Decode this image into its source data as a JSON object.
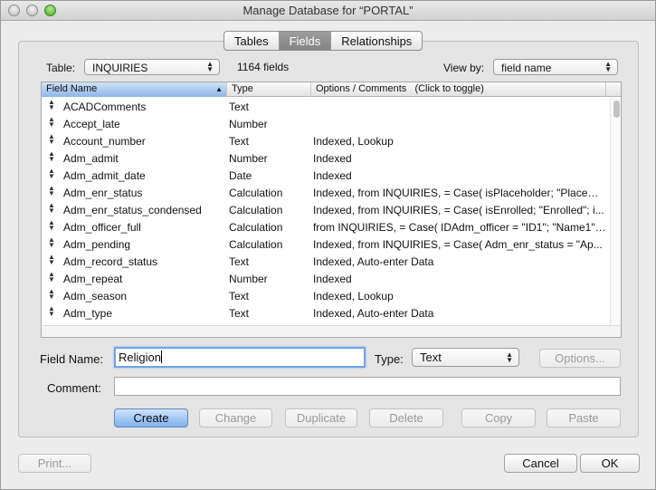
{
  "window": {
    "title": "Manage Database for “PORTAL”"
  },
  "tabs": [
    {
      "label": "Tables",
      "active": false
    },
    {
      "label": "Fields",
      "active": true
    },
    {
      "label": "Relationships",
      "active": false
    }
  ],
  "table_select": {
    "label": "Table:",
    "value": "INQUIRIES"
  },
  "field_count": "1164 fields",
  "view_by": {
    "label": "View by:",
    "value": "field name"
  },
  "columns": {
    "name": "Field Name",
    "type": "Type",
    "options": "Options / Comments",
    "toggle_hint": "(Click to toggle)"
  },
  "rows": [
    {
      "name": "ACADComments",
      "type": "Text",
      "options": ""
    },
    {
      "name": "Accept_late",
      "type": "Number",
      "options": ""
    },
    {
      "name": "Account_number",
      "type": "Text",
      "options": "Indexed, Lookup"
    },
    {
      "name": "Adm_admit",
      "type": "Number",
      "options": "Indexed"
    },
    {
      "name": "Adm_admit_date",
      "type": "Date",
      "options": "Indexed"
    },
    {
      "name": "Adm_enr_status",
      "type": "Calculation",
      "options": "Indexed, from INQUIRIES, = Case( isPlaceholder; \"PlaceHo..."
    },
    {
      "name": "Adm_enr_status_condensed",
      "type": "Calculation",
      "options": "Indexed, from INQUIRIES, = Case( isEnrolled; \"Enrolled\"; i..."
    },
    {
      "name": "Adm_officer_full",
      "type": "Calculation",
      "options": "from INQUIRIES, = Case( IDAdm_officer = \"ID1\"; \"Name1\";..."
    },
    {
      "name": "Adm_pending",
      "type": "Calculation",
      "options": "Indexed, from INQUIRIES, = Case( Adm_enr_status = \"Ap..."
    },
    {
      "name": "Adm_record_status",
      "type": "Text",
      "options": "Indexed, Auto-enter Data"
    },
    {
      "name": "Adm_repeat",
      "type": "Number",
      "options": "Indexed"
    },
    {
      "name": "Adm_season",
      "type": "Text",
      "options": "Indexed, Lookup"
    },
    {
      "name": "Adm_type",
      "type": "Text",
      "options": "Indexed, Auto-enter Data"
    }
  ],
  "field_name": {
    "label": "Field Name:",
    "value": "Religion"
  },
  "field_type": {
    "label": "Type:",
    "value": "Text"
  },
  "comment": {
    "label": "Comment:",
    "value": ""
  },
  "buttons": {
    "options": "Options...",
    "create": "Create",
    "change": "Change",
    "duplicate": "Duplicate",
    "delete": "Delete",
    "copy": "Copy",
    "paste": "Paste",
    "print": "Print...",
    "cancel": "Cancel",
    "ok": "OK"
  },
  "icons": {
    "row_handle": "reorder-handle-icon",
    "sort": "sort-ascending-icon",
    "popup": "updown-arrows-icon"
  }
}
